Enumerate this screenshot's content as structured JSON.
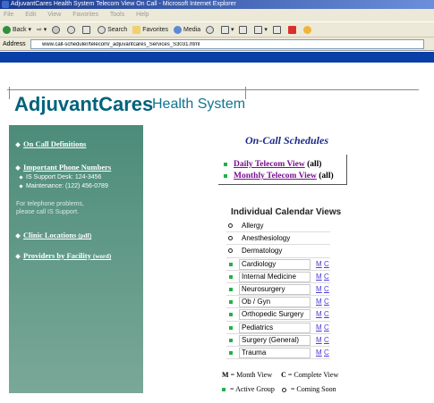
{
  "window": {
    "title": "AdjuvantCares Health System Telecom View On Call - Microsoft Internet Explorer",
    "menu": [
      "File",
      "Edit",
      "View",
      "Favorites",
      "Tools",
      "Help"
    ],
    "toolbar": {
      "back": "Back",
      "search": "Search",
      "favorites": "Favorites",
      "media": "Media"
    },
    "address_label": "Address",
    "address_value": "www.call-scheduler/telecom/_adjuvantcares_Services_S3031.html"
  },
  "header": {
    "brand": "AdjuvantCares",
    "subtitle": "Health System"
  },
  "sidebar": {
    "definitions": "On Call Definitions",
    "phone_numbers": "Important Phone Numbers",
    "is_support_desk": "IS Support Desk: 124-3456",
    "maintenance": "Maintenance: (122) 456-0789",
    "telephone_problems_line1": "For telephone problems,",
    "telephone_problems_line2": "please call IS Support.",
    "clinic_locations": "Clinic Locations",
    "clinic_locations_tag": "(pdf)",
    "providers_by_facility": "Providers by Facility",
    "providers_by_facility_tag": "(word)"
  },
  "main": {
    "title": "On-Call Schedules",
    "daily_link": "Daily Telecom View",
    "daily_suffix": "(all)",
    "monthly_link": "Monthly Telecom View",
    "monthly_suffix": "(all)",
    "calendar_title": "Individual Calendar Views",
    "calendar_items": [
      {
        "dept": "Allergy",
        "status": "soon",
        "m": "",
        "c": ""
      },
      {
        "dept": "Anesthesiology",
        "status": "soon",
        "m": "",
        "c": ""
      },
      {
        "dept": "Dermatology",
        "status": "soon",
        "m": "",
        "c": ""
      },
      {
        "dept": "Cardiology",
        "status": "active",
        "m": "M",
        "c": "C"
      },
      {
        "dept": "Internal Medicine",
        "status": "active",
        "m": "M",
        "c": "C"
      },
      {
        "dept": "Neurosurgery",
        "status": "active",
        "m": "M",
        "c": "C"
      },
      {
        "dept": "Ob / Gyn",
        "status": "active",
        "m": "M",
        "c": "C"
      },
      {
        "dept": "Orthopedic Surgery",
        "status": "active",
        "m": "M",
        "c": "C"
      },
      {
        "dept": "Pediatrics",
        "status": "active",
        "m": "M",
        "c": "C"
      },
      {
        "dept": "Surgery (General)",
        "status": "active",
        "m": "M",
        "c": "C"
      },
      {
        "dept": "Trauma",
        "status": "active",
        "m": "M",
        "c": "C"
      }
    ],
    "legend": {
      "m_key": "M",
      "m_text": "= Month View",
      "c_key": "C",
      "c_text": "= Complete View",
      "active_text": "= Active Group",
      "soon_text": "= Coming Soon"
    }
  },
  "colors": {
    "brand": "#00627b",
    "sidebar": "#4c8c79",
    "active": "#22b04a",
    "link_visited": "#7a0f8f",
    "link": "#4b3bd6",
    "nav_bar": "#0a3fa8"
  }
}
